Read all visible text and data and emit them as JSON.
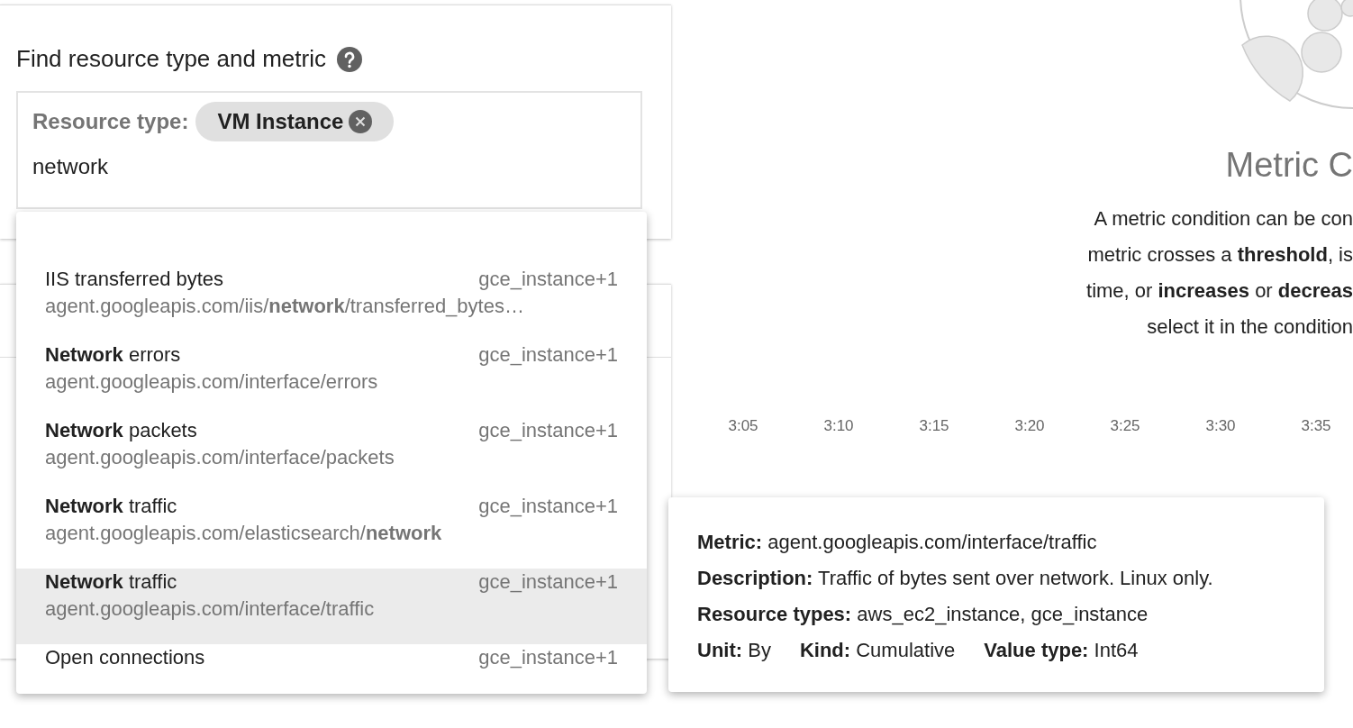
{
  "finder": {
    "title": "Find resource type and metric",
    "resource_label": "Resource type:",
    "chip": "VM Instance",
    "query": "network"
  },
  "dropdown": {
    "items": [
      {
        "title": "IIS transferred bytes",
        "resource": "gce_instance+1",
        "path": "agent.googleapis.com/iis/**network**/transferred_bytes…",
        "selected": false
      },
      {
        "title": "**Network** errors",
        "resource": "gce_instance+1",
        "path": "agent.googleapis.com/interface/errors",
        "selected": false
      },
      {
        "title": "**Network** packets",
        "resource": "gce_instance+1",
        "path": "agent.googleapis.com/interface/packets",
        "selected": false
      },
      {
        "title": "**Network** traffic",
        "resource": "gce_instance+1",
        "path": "agent.googleapis.com/elasticsearch/**network**",
        "selected": false
      },
      {
        "title": "**Network** traffic",
        "resource": "gce_instance+1",
        "path": "agent.googleapis.com/interface/traffic",
        "selected": true
      },
      {
        "title": "Open connections",
        "resource": "gce_instance+1",
        "selected": false
      }
    ]
  },
  "empty_state": {
    "title": "Metric C",
    "lines": [
      "A metric condition can be con",
      "metric crosses a **threshold**, is",
      "time, or **increases** or **decreas**",
      "select it in the condition"
    ]
  },
  "time_axis": {
    "ticks": [
      "3:05",
      "3:10",
      "3:15",
      "3:20",
      "3:25",
      "3:30",
      "3:35"
    ]
  },
  "tooltip": {
    "rows": [
      [
        {
          "label": "Metric:",
          "value": "agent.googleapis.com/interface/traffic"
        }
      ],
      [
        {
          "label": "Description:",
          "value": "Traffic of bytes sent over network. Linux only."
        }
      ],
      [
        {
          "label": "Resource types:",
          "value": "aws_ec2_instance, gce_instance"
        }
      ],
      [
        {
          "label": "Unit:",
          "value": "By"
        },
        {
          "label": "Kind:",
          "value": "Cumulative"
        },
        {
          "label": "Value type:",
          "value": "Int64"
        }
      ]
    ]
  }
}
